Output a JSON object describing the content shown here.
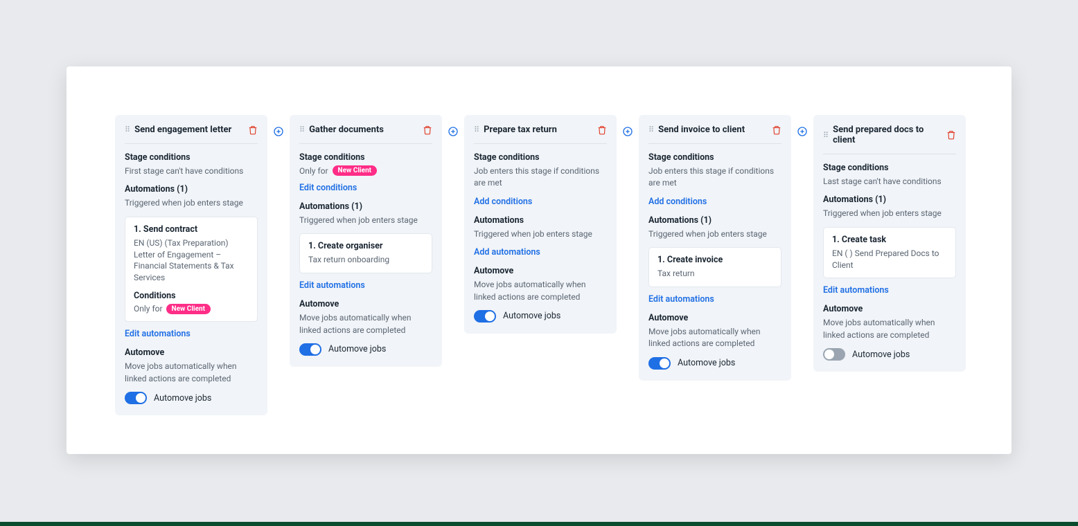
{
  "labels": {
    "stage_conditions": "Stage conditions",
    "automations_prefix": "Automations",
    "automations_trigger": "Triggered when job enters stage",
    "automove": "Automove",
    "automove_desc": "Move jobs automatically when linked actions are completed",
    "automove_toggle": "Automove jobs",
    "edit_conditions": "Edit conditions",
    "add_conditions": "Add conditions",
    "edit_automations": "Edit automations",
    "add_automations": "Add automations",
    "conditions": "Conditions",
    "only_for": "Only for",
    "new_client": "New Client"
  },
  "stages": [
    {
      "title": "Send engagement letter",
      "conditions_sub": "First stage can't have conditions",
      "conditions_link": null,
      "automations_count": 1,
      "automations": [
        {
          "title": "1. Send contract",
          "desc": "EN (US) (Tax Preparation) Letter of Engagement – Financial Statements & Tax Services",
          "has_conditions": true
        }
      ],
      "automations_link": "edit_automations",
      "automove_on": true
    },
    {
      "title": "Gather documents",
      "conditions_only_for_pill": true,
      "conditions_link": "edit_conditions",
      "automations_count": 1,
      "automations": [
        {
          "title": "1. Create organiser",
          "desc": "Tax return onboarding",
          "has_conditions": false
        }
      ],
      "automations_link": "edit_automations",
      "automove_on": true
    },
    {
      "title": "Prepare tax return",
      "conditions_sub": "Job enters this stage if conditions are met",
      "conditions_link": "add_conditions",
      "automations_count": 0,
      "automations": [],
      "automations_link": "add_automations",
      "automove_on": true
    },
    {
      "title": "Send invoice to client",
      "conditions_sub": "Job enters this stage if conditions are met",
      "conditions_link": "add_conditions",
      "automations_count": 1,
      "automations": [
        {
          "title": "1. Create invoice",
          "desc": "Tax return",
          "has_conditions": false
        }
      ],
      "automations_link": "edit_automations",
      "automove_on": true
    },
    {
      "title": "Send prepared docs to client",
      "conditions_sub": "Last stage can't have conditions",
      "conditions_link": null,
      "automations_count": 1,
      "automations": [
        {
          "title": "1. Create task",
          "desc": "EN ( ) Send Prepared Docs to Client",
          "has_conditions": false
        }
      ],
      "automations_link": "edit_automations",
      "automove_on": false
    }
  ]
}
